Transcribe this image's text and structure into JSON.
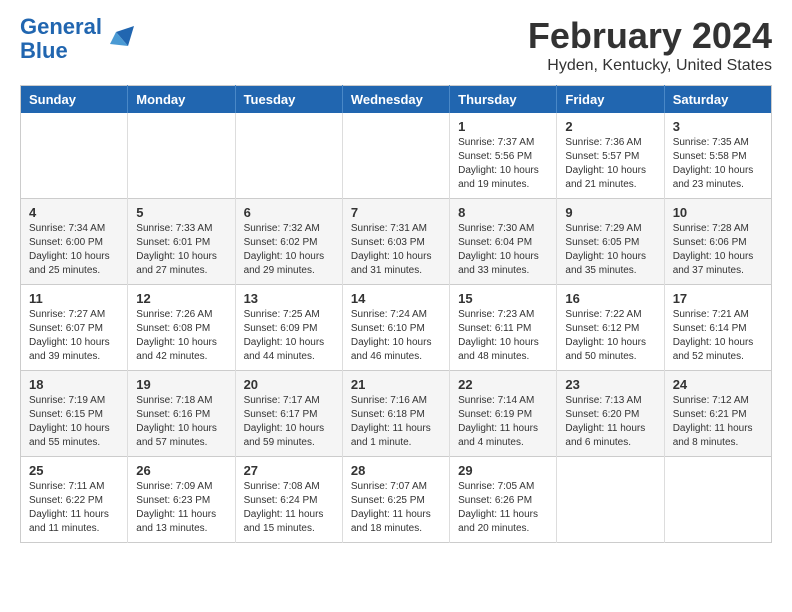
{
  "header": {
    "logo_line1": "General",
    "logo_line2": "Blue",
    "month_title": "February 2024",
    "location": "Hyden, Kentucky, United States"
  },
  "weekdays": [
    "Sunday",
    "Monday",
    "Tuesday",
    "Wednesday",
    "Thursday",
    "Friday",
    "Saturday"
  ],
  "weeks": [
    [
      {
        "day": "",
        "info": ""
      },
      {
        "day": "",
        "info": ""
      },
      {
        "day": "",
        "info": ""
      },
      {
        "day": "",
        "info": ""
      },
      {
        "day": "1",
        "info": "Sunrise: 7:37 AM\nSunset: 5:56 PM\nDaylight: 10 hours and 19 minutes."
      },
      {
        "day": "2",
        "info": "Sunrise: 7:36 AM\nSunset: 5:57 PM\nDaylight: 10 hours and 21 minutes."
      },
      {
        "day": "3",
        "info": "Sunrise: 7:35 AM\nSunset: 5:58 PM\nDaylight: 10 hours and 23 minutes."
      }
    ],
    [
      {
        "day": "4",
        "info": "Sunrise: 7:34 AM\nSunset: 6:00 PM\nDaylight: 10 hours and 25 minutes."
      },
      {
        "day": "5",
        "info": "Sunrise: 7:33 AM\nSunset: 6:01 PM\nDaylight: 10 hours and 27 minutes."
      },
      {
        "day": "6",
        "info": "Sunrise: 7:32 AM\nSunset: 6:02 PM\nDaylight: 10 hours and 29 minutes."
      },
      {
        "day": "7",
        "info": "Sunrise: 7:31 AM\nSunset: 6:03 PM\nDaylight: 10 hours and 31 minutes."
      },
      {
        "day": "8",
        "info": "Sunrise: 7:30 AM\nSunset: 6:04 PM\nDaylight: 10 hours and 33 minutes."
      },
      {
        "day": "9",
        "info": "Sunrise: 7:29 AM\nSunset: 6:05 PM\nDaylight: 10 hours and 35 minutes."
      },
      {
        "day": "10",
        "info": "Sunrise: 7:28 AM\nSunset: 6:06 PM\nDaylight: 10 hours and 37 minutes."
      }
    ],
    [
      {
        "day": "11",
        "info": "Sunrise: 7:27 AM\nSunset: 6:07 PM\nDaylight: 10 hours and 39 minutes."
      },
      {
        "day": "12",
        "info": "Sunrise: 7:26 AM\nSunset: 6:08 PM\nDaylight: 10 hours and 42 minutes."
      },
      {
        "day": "13",
        "info": "Sunrise: 7:25 AM\nSunset: 6:09 PM\nDaylight: 10 hours and 44 minutes."
      },
      {
        "day": "14",
        "info": "Sunrise: 7:24 AM\nSunset: 6:10 PM\nDaylight: 10 hours and 46 minutes."
      },
      {
        "day": "15",
        "info": "Sunrise: 7:23 AM\nSunset: 6:11 PM\nDaylight: 10 hours and 48 minutes."
      },
      {
        "day": "16",
        "info": "Sunrise: 7:22 AM\nSunset: 6:12 PM\nDaylight: 10 hours and 50 minutes."
      },
      {
        "day": "17",
        "info": "Sunrise: 7:21 AM\nSunset: 6:14 PM\nDaylight: 10 hours and 52 minutes."
      }
    ],
    [
      {
        "day": "18",
        "info": "Sunrise: 7:19 AM\nSunset: 6:15 PM\nDaylight: 10 hours and 55 minutes."
      },
      {
        "day": "19",
        "info": "Sunrise: 7:18 AM\nSunset: 6:16 PM\nDaylight: 10 hours and 57 minutes."
      },
      {
        "day": "20",
        "info": "Sunrise: 7:17 AM\nSunset: 6:17 PM\nDaylight: 10 hours and 59 minutes."
      },
      {
        "day": "21",
        "info": "Sunrise: 7:16 AM\nSunset: 6:18 PM\nDaylight: 11 hours and 1 minute."
      },
      {
        "day": "22",
        "info": "Sunrise: 7:14 AM\nSunset: 6:19 PM\nDaylight: 11 hours and 4 minutes."
      },
      {
        "day": "23",
        "info": "Sunrise: 7:13 AM\nSunset: 6:20 PM\nDaylight: 11 hours and 6 minutes."
      },
      {
        "day": "24",
        "info": "Sunrise: 7:12 AM\nSunset: 6:21 PM\nDaylight: 11 hours and 8 minutes."
      }
    ],
    [
      {
        "day": "25",
        "info": "Sunrise: 7:11 AM\nSunset: 6:22 PM\nDaylight: 11 hours and 11 minutes."
      },
      {
        "day": "26",
        "info": "Sunrise: 7:09 AM\nSunset: 6:23 PM\nDaylight: 11 hours and 13 minutes."
      },
      {
        "day": "27",
        "info": "Sunrise: 7:08 AM\nSunset: 6:24 PM\nDaylight: 11 hours and 15 minutes."
      },
      {
        "day": "28",
        "info": "Sunrise: 7:07 AM\nSunset: 6:25 PM\nDaylight: 11 hours and 18 minutes."
      },
      {
        "day": "29",
        "info": "Sunrise: 7:05 AM\nSunset: 6:26 PM\nDaylight: 11 hours and 20 minutes."
      },
      {
        "day": "",
        "info": ""
      },
      {
        "day": "",
        "info": ""
      }
    ]
  ]
}
